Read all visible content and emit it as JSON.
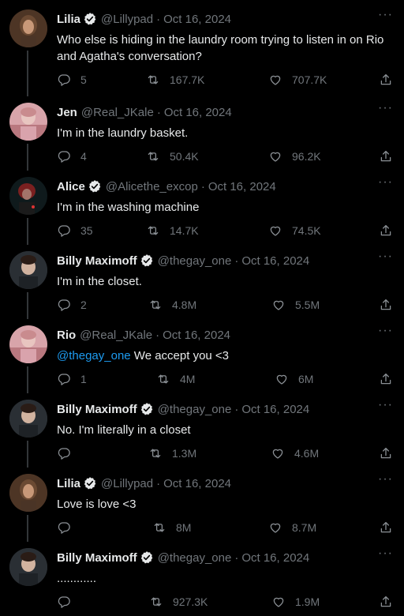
{
  "tweets": [
    {
      "name": "Lilia",
      "verified": true,
      "handle": "@Lillypad",
      "date": "Oct 16, 2024",
      "text": "Who else is hiding in the laundry room trying to listen in on Rio and Agatha's conversation?",
      "mention": "",
      "replies": "5",
      "retweets": "167.7K",
      "likes": "707.7K",
      "avatar": "lilia"
    },
    {
      "name": "Jen",
      "verified": false,
      "handle": "@Real_JKale",
      "date": "Oct 16, 2024",
      "text": "I'm in the laundry basket.",
      "mention": "",
      "replies": "4",
      "retweets": "50.4K",
      "likes": "96.2K",
      "avatar": "pink"
    },
    {
      "name": "Alice",
      "verified": true,
      "handle": "@Alicethe_excop",
      "date": "Oct 16, 2024",
      "text": "I'm in the washing machine",
      "mention": "",
      "replies": "35",
      "retweets": "14.7K",
      "likes": "74.5K",
      "avatar": "alice"
    },
    {
      "name": "Billy Maximoff",
      "verified": true,
      "handle": "@thegay_one",
      "date": "Oct 16, 2024",
      "text": "I'm in the closet.",
      "mention": "",
      "replies": "2",
      "retweets": "4.8M",
      "likes": "5.5M",
      "avatar": "billy"
    },
    {
      "name": "Rio",
      "verified": false,
      "handle": "@Real_JKale",
      "date": "Oct 16, 2024",
      "text": " We accept you <3",
      "mention": "@thegay_one",
      "replies": "1",
      "retweets": "4M",
      "likes": "6M",
      "avatar": "pink"
    },
    {
      "name": "Billy Maximoff",
      "verified": true,
      "handle": "@thegay_one",
      "date": "Oct 16, 2024",
      "text": "No. I'm literally in a closet",
      "mention": "",
      "replies": "",
      "retweets": "1.3M",
      "likes": "4.6M",
      "avatar": "billy"
    },
    {
      "name": "Lilia",
      "verified": true,
      "handle": "@Lillypad",
      "date": "Oct 16, 2024",
      "text": "Love is love <3",
      "mention": "",
      "replies": "",
      "retweets": "8M",
      "likes": "8.7M",
      "avatar": "lilia"
    },
    {
      "name": "Billy Maximoff",
      "verified": true,
      "handle": "@thegay_one",
      "date": "Oct 16, 2024",
      "text": "............",
      "mention": "",
      "replies": "",
      "retweets": "927.3K",
      "likes": "1.9M",
      "avatar": "billy"
    }
  ],
  "more_label": "···",
  "colors": {
    "background": "#000000",
    "text": "#e7e9ea",
    "muted": "#71767b",
    "link": "#1d9bf0",
    "verified": "#e7e9ea"
  },
  "icons": {
    "reply": "reply-icon",
    "retweet": "retweet-icon",
    "like": "heart-icon",
    "share": "share-icon",
    "verified": "verified-badge-icon",
    "more": "more-icon"
  }
}
